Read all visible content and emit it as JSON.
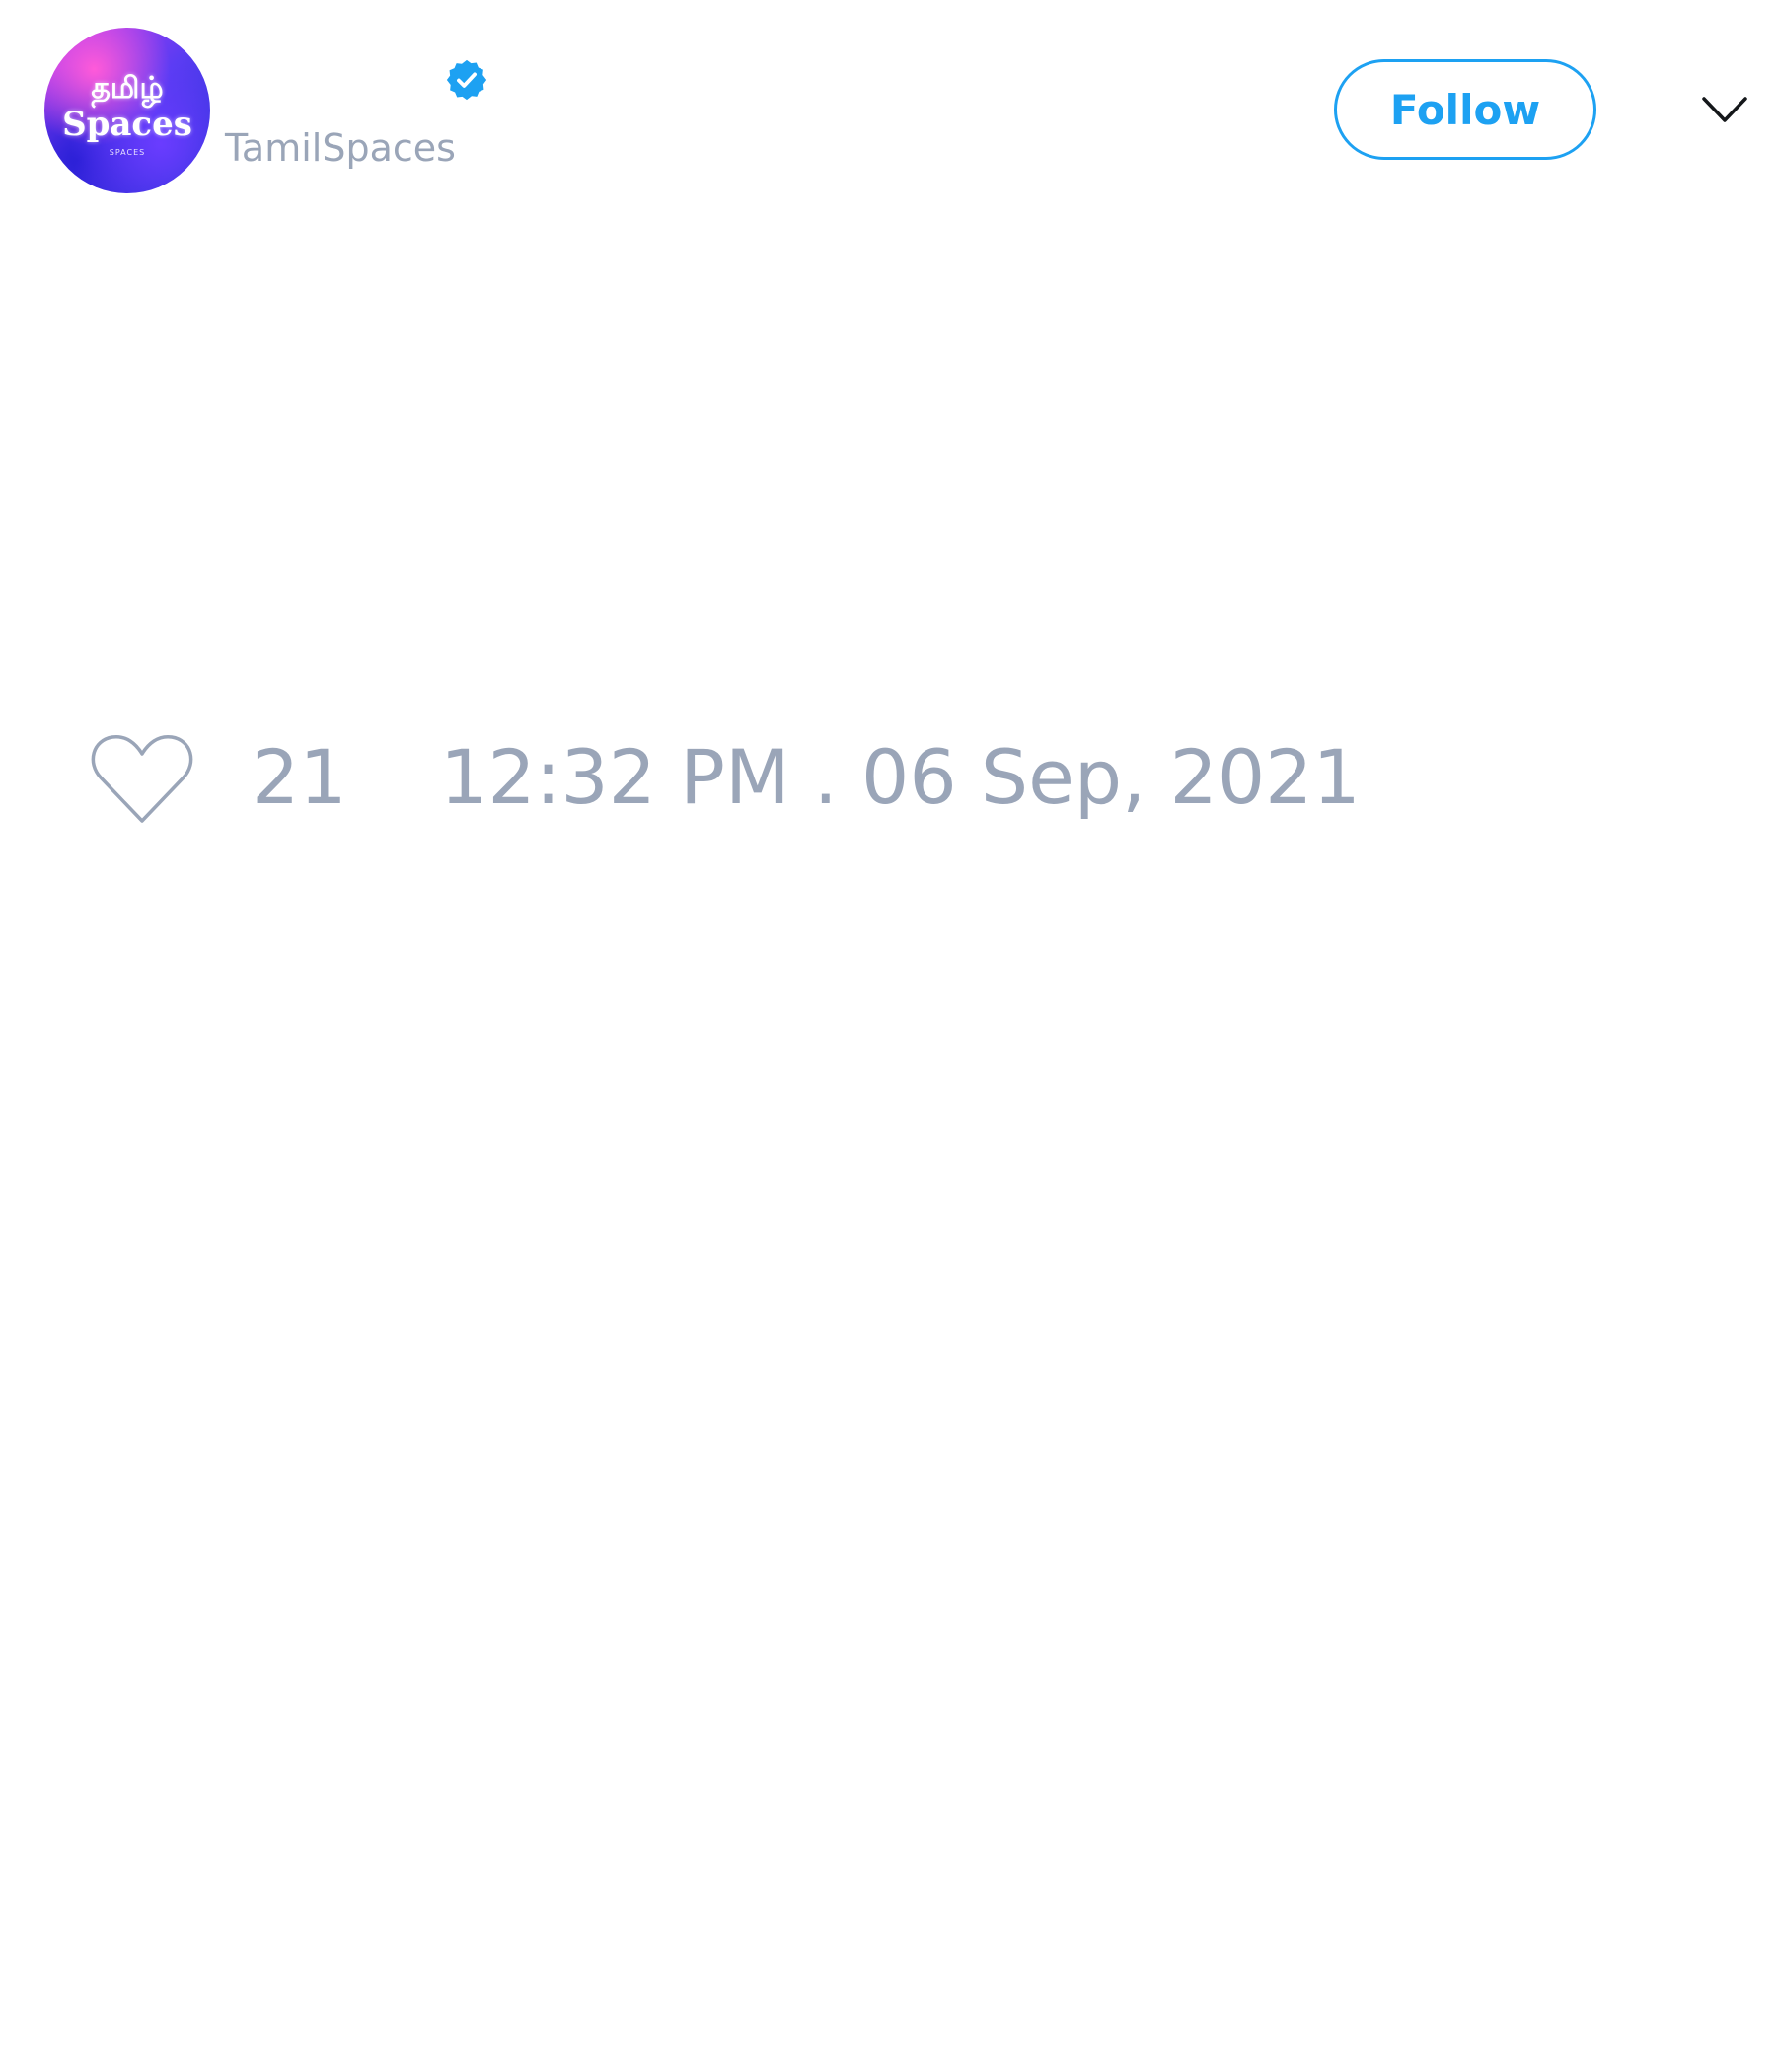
{
  "tweet": {
    "author": {
      "display_name": "",
      "handle": "TamilSpaces",
      "verified": true,
      "avatar_logo": {
        "line1": "தமிழ்",
        "line2": "Spaces",
        "line3": "SPACES"
      }
    },
    "follow_label": "Follow",
    "like_count": "21",
    "timestamp": "12:32 PM . 06 Sep, 2021"
  },
  "icons": {
    "verified": "verified-badge-icon",
    "menu": "chevron-down-icon",
    "like": "heart-outline-icon"
  },
  "colors": {
    "accent": "#1da1f2",
    "muted_text": "#9aa5b8",
    "background": "#ffffff"
  }
}
